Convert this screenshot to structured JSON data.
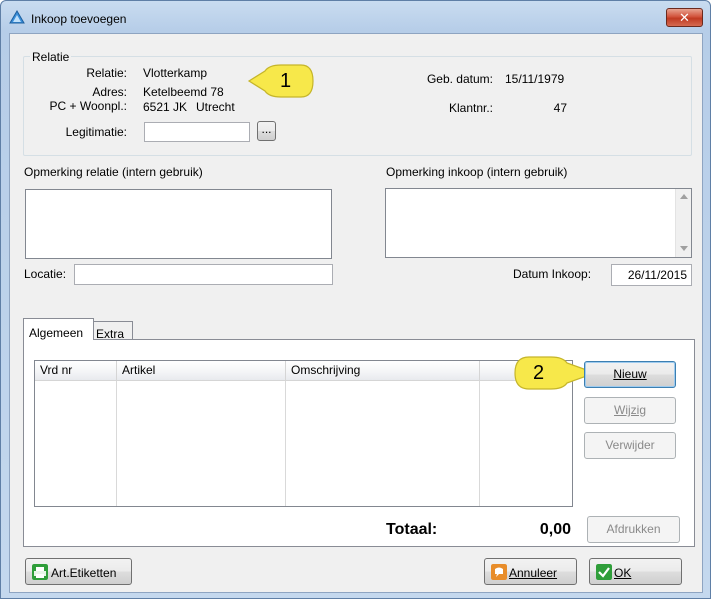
{
  "window": {
    "title": "Inkoop toevoegen",
    "close_glyph": "✕"
  },
  "relatie": {
    "group_label": "Relatie",
    "relatie_label": "Relatie:",
    "relatie_value": "Vlotterkamp",
    "adres_label": "Adres:",
    "adres_value": "Ketelbeemd 78",
    "pc_label": "PC + Woonpl.:",
    "pc_value": "6521 JK",
    "woonplaats_value": "Utrecht",
    "legitimatie_label": "Legitimatie:",
    "legitimatie_value": "",
    "browse_label": "...",
    "gebdatum_label": "Geb. datum:",
    "gebdatum_value": "15/11/1979",
    "klantnr_label": "Klantnr.:",
    "klantnr_value": "47"
  },
  "callouts": {
    "one": "1",
    "two": "2",
    "color": "#f7e84a"
  },
  "opmerking": {
    "relatie_label": "Opmerking relatie (intern gebruik)",
    "relatie_value": "",
    "inkoop_label": "Opmerking inkoop (intern gebruik)",
    "inkoop_value": ""
  },
  "locatie": {
    "label": "Locatie:",
    "value": ""
  },
  "datum_inkoop": {
    "label": "Datum Inkoop:",
    "value": "26/11/2015"
  },
  "tabs": [
    {
      "label": "Algemeen",
      "active": true
    },
    {
      "label": "Extra",
      "active": false
    }
  ],
  "grid": {
    "columns": [
      "Vrd nr",
      "Artikel",
      "Omschrijving",
      ""
    ],
    "rows": []
  },
  "buttons": {
    "nieuw": "Nieuw",
    "wijzig": "Wijzig",
    "verwijder": "Verwijder",
    "afdrukken": "Afdrukken",
    "art_etiketten": "Art.Etiketten",
    "annuleer": "Annuleer",
    "ok": "OK"
  },
  "totaal": {
    "label": "Totaal:",
    "value": "0,00"
  }
}
